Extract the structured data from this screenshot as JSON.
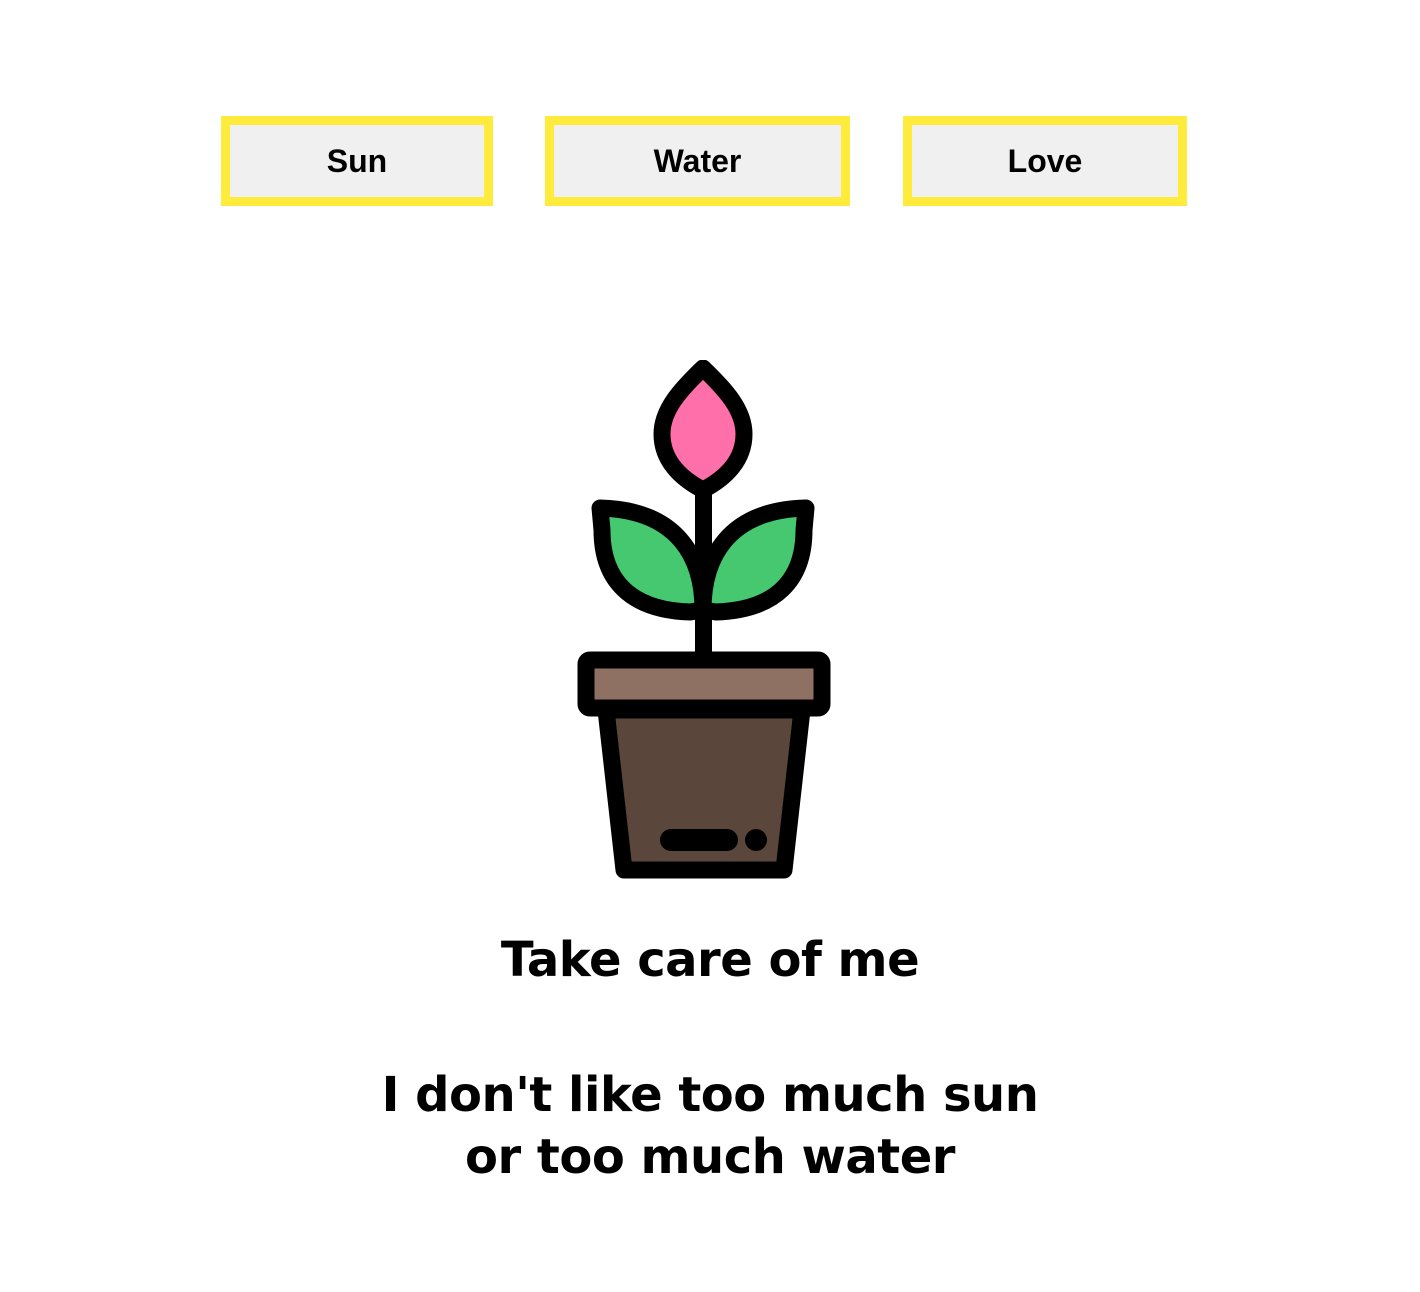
{
  "buttons": {
    "sun_label": "Sun",
    "water_label": "Water",
    "love_label": "Love"
  },
  "plant": {
    "icon": "potted-plant-icon",
    "colors": {
      "outline": "#000000",
      "flower": "#ff6fa9",
      "leaves": "#45c86f",
      "pot_rim": "#8f7163",
      "pot_body": "#5b463b"
    }
  },
  "heading": "Take care of me",
  "message": {
    "line1": "I don't like too much sun",
    "line2": "or too much water"
  },
  "theme": {
    "button_border": "#ffeb3b",
    "button_background": "#f0f0f0"
  }
}
